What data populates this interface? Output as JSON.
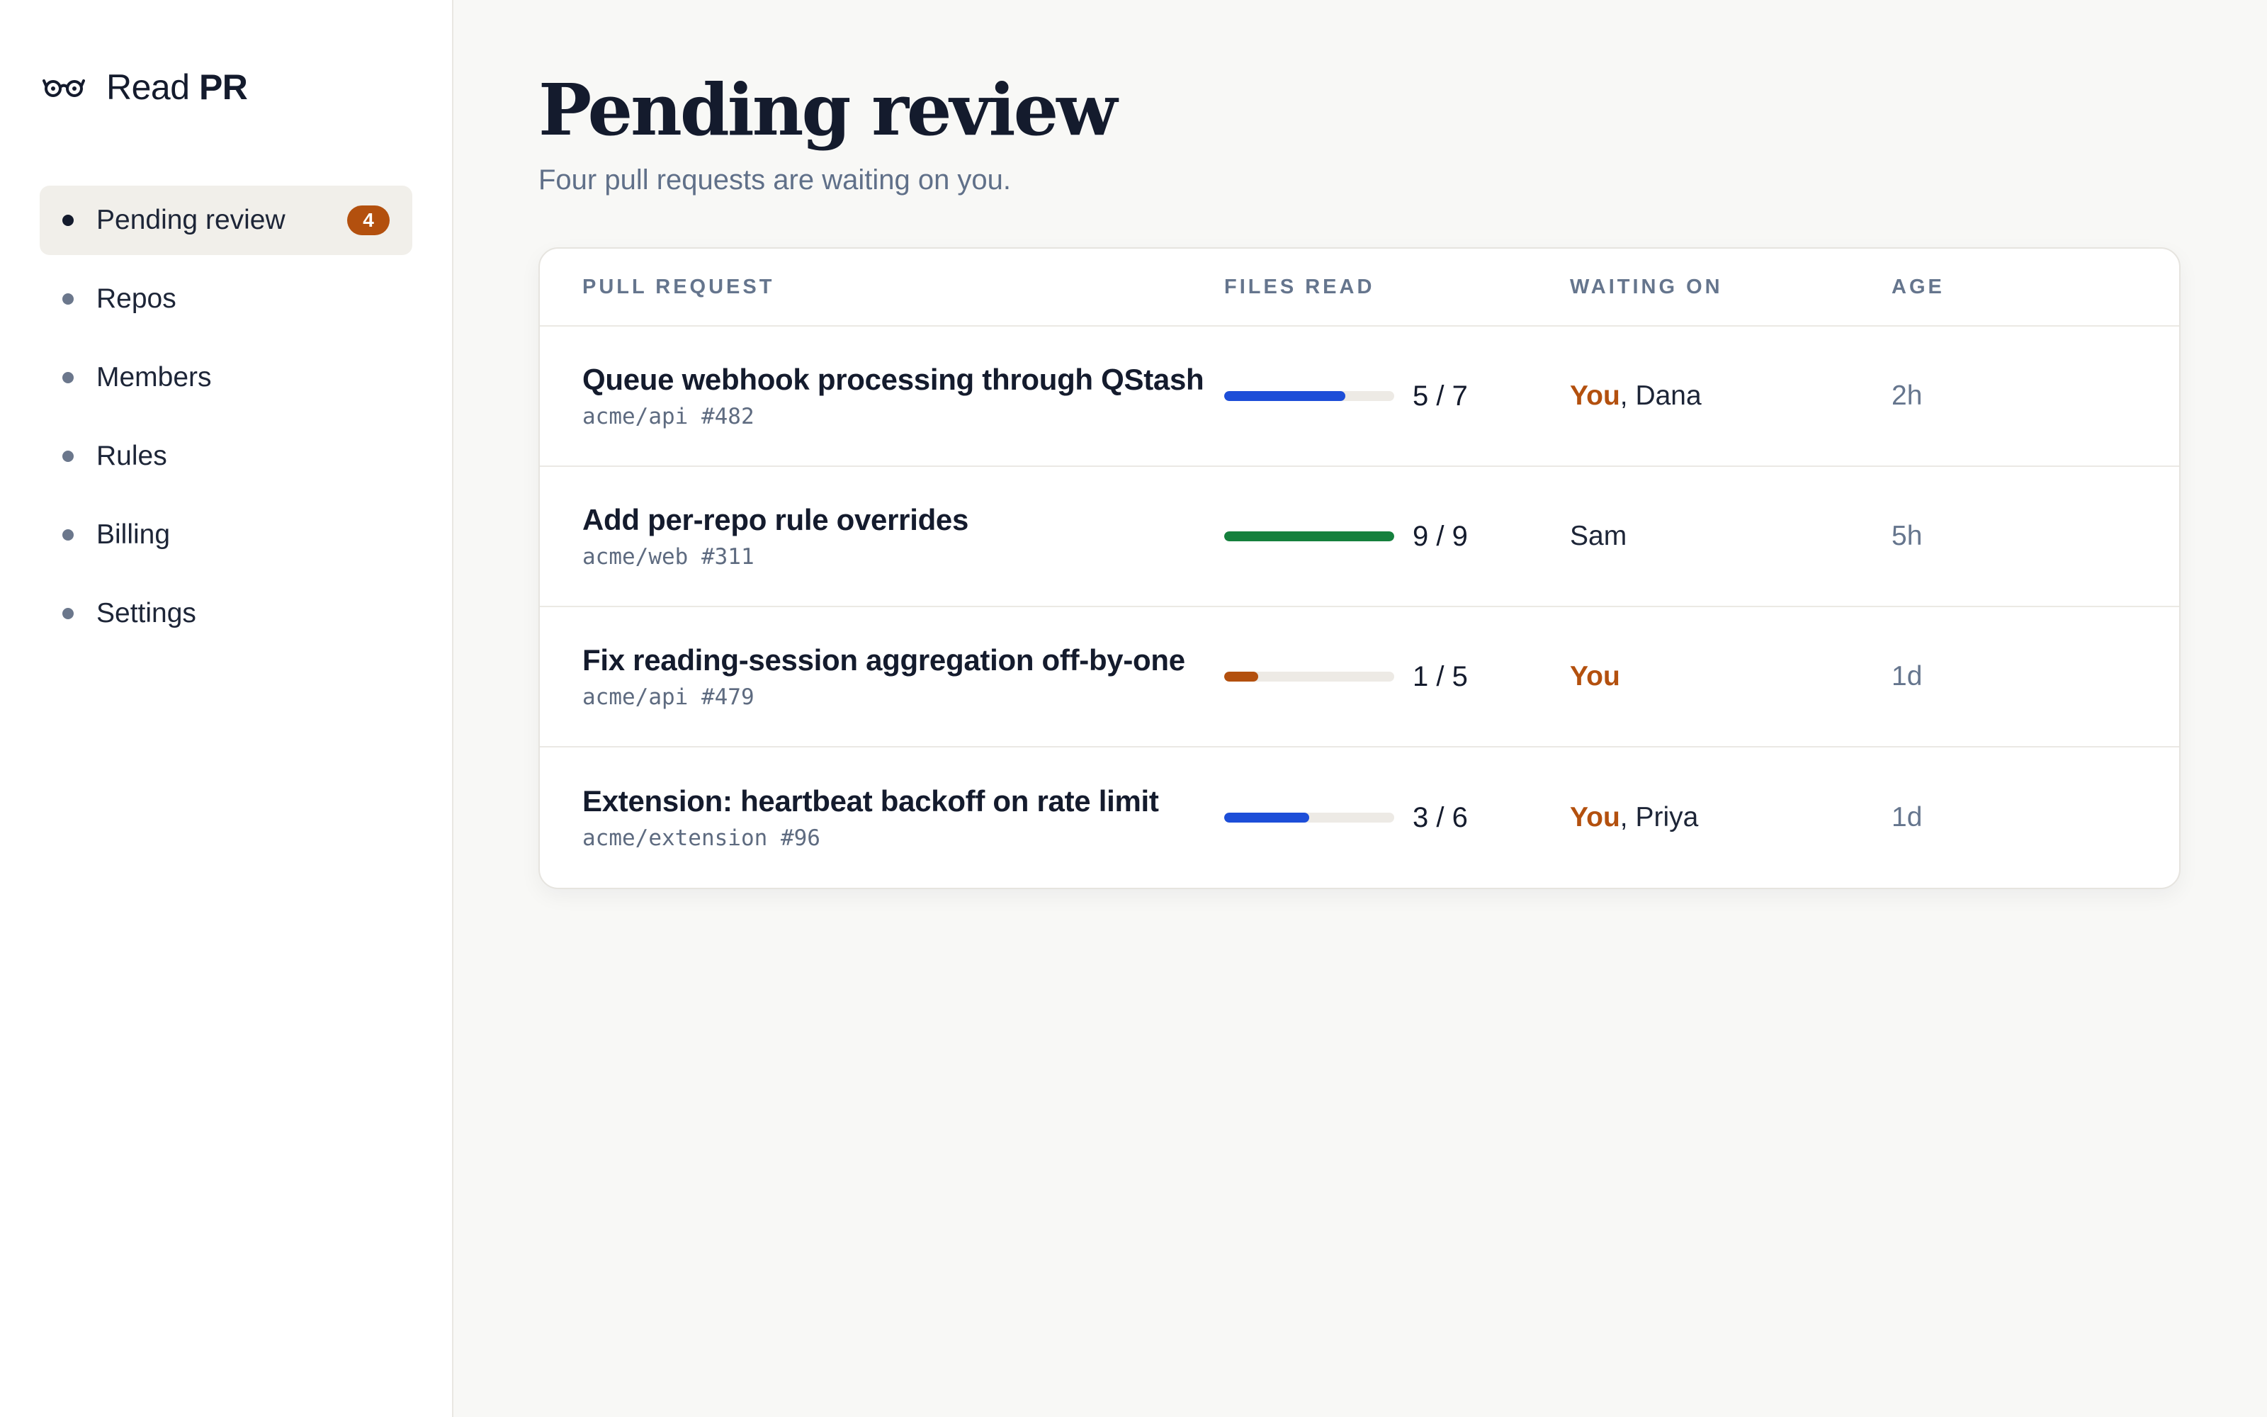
{
  "brand": {
    "name_prefix": "Read ",
    "name_strong": "PR",
    "icon": "glasses-icon"
  },
  "sidebar": {
    "items": [
      {
        "label": "Pending review",
        "badge": "4",
        "active": true
      },
      {
        "label": "Repos"
      },
      {
        "label": "Members"
      },
      {
        "label": "Rules"
      },
      {
        "label": "Billing"
      },
      {
        "label": "Settings"
      }
    ]
  },
  "page": {
    "title": "Pending review",
    "subtitle": "Four pull requests are waiting on you."
  },
  "table": {
    "headers": {
      "pull_request": "PULL REQUEST",
      "files_read": "FILES READ",
      "waiting_on": "WAITING ON",
      "age": "AGE"
    },
    "rows": [
      {
        "title": "Queue webhook processing through QStash",
        "ref": "acme/api #482",
        "files": "5 / 7",
        "progress": 0.714,
        "progress_color": "#1d4ed8",
        "waiting_you": "You",
        "waiting_sep": ", ",
        "waiting_others": "Dana",
        "age": "2h"
      },
      {
        "title": "Add per-repo rule overrides",
        "ref": "acme/web #311",
        "files": "9 / 9",
        "progress": 1.0,
        "progress_color": "#15803d",
        "waiting_you": "",
        "waiting_sep": "",
        "waiting_others": "Sam",
        "age": "5h"
      },
      {
        "title": "Fix reading-session aggregation off-by-one",
        "ref": "acme/api #479",
        "files": "1 / 5",
        "progress": 0.2,
        "progress_color": "#b3500e",
        "waiting_you": "You",
        "waiting_sep": "",
        "waiting_others": "",
        "age": "1d"
      },
      {
        "title": "Extension: heartbeat backoff on rate limit",
        "ref": "acme/extension #96",
        "files": "3 / 6",
        "progress": 0.5,
        "progress_color": "#1d4ed8",
        "waiting_you": "You",
        "waiting_sep": ", ",
        "waiting_others": "Priya",
        "age": "1d"
      }
    ]
  },
  "colors": {
    "accent_orange": "#b3500e",
    "progress_blue": "#1d4ed8",
    "progress_green": "#15803d",
    "text_dark": "#141b2d",
    "text_muted": "#607089"
  }
}
